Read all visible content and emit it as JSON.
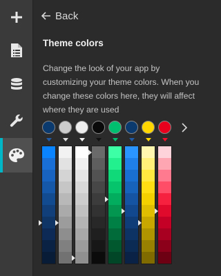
{
  "rail": {
    "items": [
      {
        "icon": "plus-icon"
      },
      {
        "icon": "document-icon"
      },
      {
        "icon": "database-icon"
      },
      {
        "icon": "wrench-icon"
      },
      {
        "icon": "palette-icon",
        "active": true
      }
    ]
  },
  "panel": {
    "back_label": "Back",
    "title": "Theme colors",
    "description": "Change the look of your app by customizing your theme colors. When you change these colors here, they will affect where they are used"
  },
  "theme_colors": [
    {
      "color": "#0b3a6e",
      "indicator": "#1f5aa6",
      "shades": [
        "#0a84ff",
        "#1a6fd6",
        "#1763bf",
        "#1557a8",
        "#134b90",
        "#113f79",
        "#0f3466",
        "#0c2a55",
        "#0a2345",
        "#081c38"
      ],
      "marker_shade": 6
    },
    {
      "color": "#cccccc",
      "indicator": "#dddddd",
      "shades": [
        "#f2f2f2",
        "#e2e2e2",
        "#d4d4d4",
        "#c6c6c6",
        "#b8b8b8",
        "#aaaaaa",
        "#9c9c9c",
        "#8e8e8e",
        "#808080",
        "#727272"
      ],
      "marker_shade": 6
    },
    {
      "color": "#eeeeee",
      "indicator": "#f2f2f2",
      "shades": [
        "#ffffff",
        "#f0f0f0",
        "#e4e4e4",
        "#d8d8d8",
        "#cccccc",
        "#c0c0c0",
        "#b4b4b4",
        "#a8a8a8",
        "#9c9c9c",
        "#909090"
      ],
      "marker_shade": 9
    },
    {
      "color": "#0a0a0a",
      "indicator": "#111111",
      "shades": [
        "#6a6a6a",
        "#5e5e5e",
        "#525252",
        "#474747",
        "#3c3c3c",
        "#323232",
        "#282828",
        "#1f1f1f",
        "#171717",
        "#0b0b0b"
      ],
      "marker_shade": 0
    },
    {
      "color": "#00c070",
      "indicator": "#00c070",
      "shades": [
        "#3dffa6",
        "#22f08e",
        "#10d97a",
        "#05c46b",
        "#02ad5e",
        "#029651",
        "#018045",
        "#016b3a",
        "#01582f",
        "#014626"
      ],
      "marker_shade": 4
    },
    {
      "color": "#0b3a6e",
      "indicator": "#1f5aa6",
      "shades": [
        "#2a94ff",
        "#1f80ea",
        "#1a70d2",
        "#1762bb",
        "#1454a3",
        "#12488d",
        "#0f3d78",
        "#0d3365",
        "#0b2a54",
        "#092245"
      ],
      "marker_shade": 5
    },
    {
      "color": "#ffd600",
      "indicator": "#ffd600",
      "shades": [
        "#fff6b0",
        "#fff07a",
        "#ffe83f",
        "#ffdf14",
        "#f5d000",
        "#e0bd00",
        "#c8a800",
        "#b09400",
        "#988000",
        "#806b00"
      ],
      "marker_shade": 6
    },
    {
      "color": "#e8001c",
      "indicator": "#f0102b",
      "shades": [
        "#ffd3da",
        "#ffa6b3",
        "#ff7a8e",
        "#ff4d67",
        "#f5213f",
        "#df0a2c",
        "#c50026",
        "#a80020",
        "#8c001a",
        "#6e0014"
      ],
      "marker_shade": 5
    }
  ]
}
